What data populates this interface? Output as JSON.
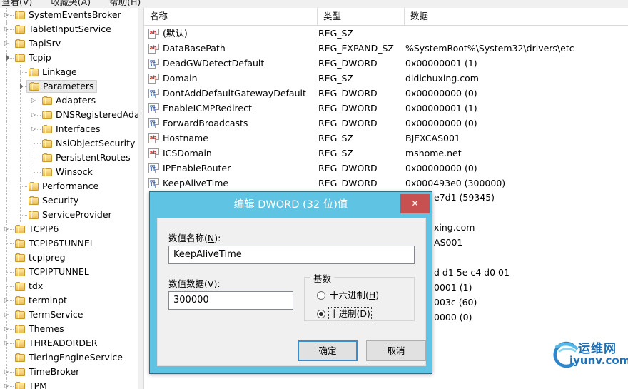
{
  "menu": {
    "items": [
      "查看(V)",
      "收藏夹(A)",
      "帮助(H)"
    ]
  },
  "tree": {
    "items": [
      {
        "label": "SystemEventsBroker",
        "depth": 0,
        "expander": "collapsed",
        "selected": false
      },
      {
        "label": "TabletInputService",
        "depth": 0,
        "expander": "collapsed",
        "selected": false
      },
      {
        "label": "TapiSrv",
        "depth": 0,
        "expander": "collapsed",
        "selected": false
      },
      {
        "label": "Tcpip",
        "depth": 0,
        "expander": "expanded",
        "selected": false
      },
      {
        "label": "Linkage",
        "depth": 1,
        "expander": "none",
        "selected": false
      },
      {
        "label": "Parameters",
        "depth": 1,
        "expander": "expanded",
        "selected": true
      },
      {
        "label": "Adapters",
        "depth": 2,
        "expander": "collapsed",
        "selected": false
      },
      {
        "label": "DNSRegisteredAda",
        "depth": 2,
        "expander": "collapsed",
        "selected": false
      },
      {
        "label": "Interfaces",
        "depth": 2,
        "expander": "collapsed",
        "selected": false
      },
      {
        "label": "NsiObjectSecurity",
        "depth": 2,
        "expander": "none",
        "selected": false
      },
      {
        "label": "PersistentRoutes",
        "depth": 2,
        "expander": "none",
        "selected": false
      },
      {
        "label": "Winsock",
        "depth": 2,
        "expander": "none",
        "selected": false
      },
      {
        "label": "Performance",
        "depth": 1,
        "expander": "none",
        "selected": false
      },
      {
        "label": "Security",
        "depth": 1,
        "expander": "none",
        "selected": false
      },
      {
        "label": "ServiceProvider",
        "depth": 1,
        "expander": "none",
        "selected": false
      },
      {
        "label": "TCPIP6",
        "depth": 0,
        "expander": "collapsed",
        "selected": false
      },
      {
        "label": "TCPIP6TUNNEL",
        "depth": 0,
        "expander": "none",
        "selected": false
      },
      {
        "label": "tcpipreg",
        "depth": 0,
        "expander": "none",
        "selected": false
      },
      {
        "label": "TCPIPTUNNEL",
        "depth": 0,
        "expander": "none",
        "selected": false
      },
      {
        "label": "tdx",
        "depth": 0,
        "expander": "none",
        "selected": false
      },
      {
        "label": "terminpt",
        "depth": 0,
        "expander": "collapsed",
        "selected": false
      },
      {
        "label": "TermService",
        "depth": 0,
        "expander": "collapsed",
        "selected": false
      },
      {
        "label": "Themes",
        "depth": 0,
        "expander": "collapsed",
        "selected": false
      },
      {
        "label": "THREADORDER",
        "depth": 0,
        "expander": "collapsed",
        "selected": false
      },
      {
        "label": "TieringEngineService",
        "depth": 0,
        "expander": "none",
        "selected": false
      },
      {
        "label": "TimeBroker",
        "depth": 0,
        "expander": "collapsed",
        "selected": false
      },
      {
        "label": "TPM",
        "depth": 0,
        "expander": "collapsed",
        "selected": false
      }
    ],
    "scrollbar": {
      "up_glyph": "▲",
      "down_glyph": "▼"
    }
  },
  "list": {
    "columns": [
      "名称",
      "类型",
      "数据"
    ],
    "rows": [
      {
        "name": "(默认)",
        "type": "REG_SZ",
        "data": "",
        "icon": "string-value-icon"
      },
      {
        "name": "DataBasePath",
        "type": "REG_EXPAND_SZ",
        "data": "%SystemRoot%\\System32\\drivers\\etc",
        "icon": "string-value-icon"
      },
      {
        "name": "DeadGWDetectDefault",
        "type": "REG_DWORD",
        "data": "0x00000001 (1)",
        "icon": "dword-value-icon"
      },
      {
        "name": "Domain",
        "type": "REG_SZ",
        "data": "didichuxing.com",
        "icon": "string-value-icon"
      },
      {
        "name": "DontAddDefaultGatewayDefault",
        "type": "REG_DWORD",
        "data": "0x00000000 (0)",
        "icon": "dword-value-icon"
      },
      {
        "name": "EnableICMPRedirect",
        "type": "REG_DWORD",
        "data": "0x00000001 (1)",
        "icon": "dword-value-icon"
      },
      {
        "name": "ForwardBroadcasts",
        "type": "REG_DWORD",
        "data": "0x00000000 (0)",
        "icon": "dword-value-icon"
      },
      {
        "name": "Hostname",
        "type": "REG_SZ",
        "data": "BJEXCAS001",
        "icon": "string-value-icon"
      },
      {
        "name": "ICSDomain",
        "type": "REG_SZ",
        "data": "mshome.net",
        "icon": "string-value-icon"
      },
      {
        "name": "IPEnableRouter",
        "type": "REG_DWORD",
        "data": "0x00000000 (0)",
        "icon": "dword-value-icon"
      },
      {
        "name": "KeepAliveTime",
        "type": "REG_DWORD",
        "data": "0x000493e0 (300000)",
        "icon": "dword-value-icon"
      }
    ],
    "obscured_rows": [
      {
        "data": "e7d1 (59345)"
      },
      {
        "data": ""
      },
      {
        "data": "xing.com"
      },
      {
        "data": "AS001"
      },
      {
        "data": ""
      },
      {
        "data": "d d1 5e c4 d0 01"
      },
      {
        "data": "0001 (1)"
      },
      {
        "data": "003c (60)"
      },
      {
        "data": "0000 (0)"
      }
    ]
  },
  "dialog": {
    "title": "编辑 DWORD (32 位)值",
    "close_label": "✕",
    "value_name_label": "数值名称(N):",
    "value_name": "KeepAliveTime",
    "value_data_label": "数值数据(V):",
    "value_data": "300000",
    "base_group_label": "基数",
    "radio_hex": "十六进制(H)",
    "radio_dec": "十进制(D)",
    "selected_base": "十进制(D)",
    "ok_label": "确定",
    "cancel_label": "取消",
    "accent_color": "#5fc3e4",
    "close_color": "#c75050",
    "default_button_border": "#3c8ccb"
  },
  "watermark": {
    "cn_text": "运维网",
    "domain_text": "iyunv.com",
    "color": "#1f6fb4"
  }
}
